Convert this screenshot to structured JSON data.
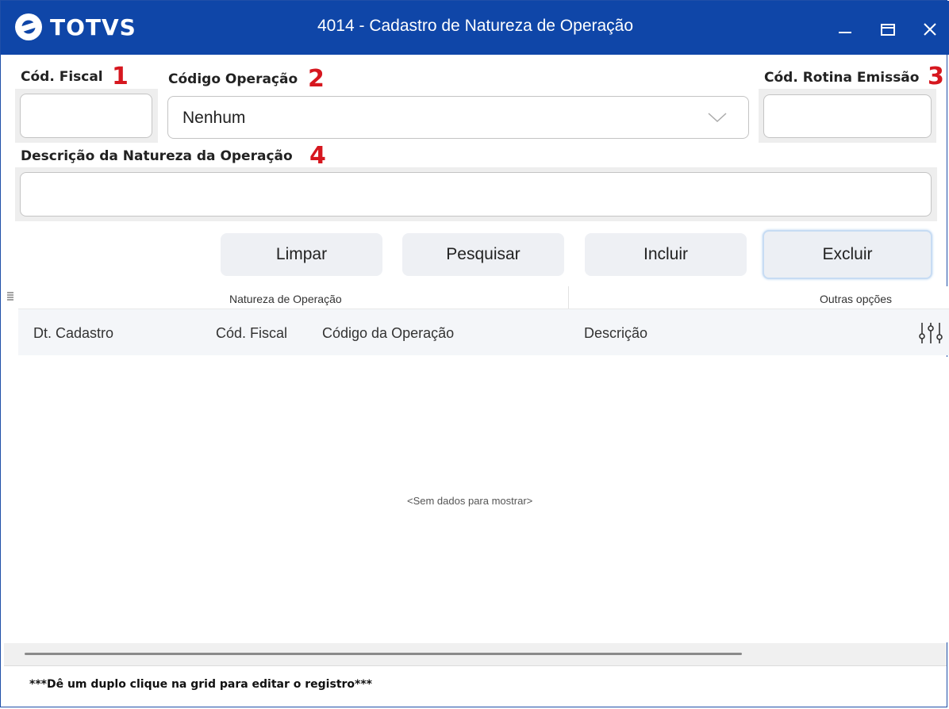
{
  "app": {
    "brand": "TOTVS",
    "title": "4014 - Cadastro de Natureza de Operação"
  },
  "fields": {
    "cod_fiscal": {
      "label": "Cód. Fiscal",
      "marker": "1",
      "value": ""
    },
    "codigo_operacao": {
      "label": "Código Operação",
      "marker": "2",
      "selected": "Nenhum"
    },
    "cod_rotina": {
      "label": "Cód. Rotina Emissão",
      "marker": "3",
      "value": ""
    },
    "descricao": {
      "label": "Descrição da Natureza da Operação",
      "marker": "4",
      "value": ""
    }
  },
  "buttons": {
    "limpar": "Limpar",
    "pesquisar": "Pesquisar",
    "incluir": "Incluir",
    "excluir": "Excluir"
  },
  "grid": {
    "group_headers": [
      "Natureza de Operação",
      "Outras opções"
    ],
    "columns": [
      "Dt. Cadastro",
      "Cód. Fiscal",
      "Código da Operação",
      "Descrição"
    ],
    "empty_text": "<Sem dados para mostrar>"
  },
  "footer": {
    "hint": "***Dê um duplo clique na grid para editar o registro***"
  },
  "colors": {
    "titlebar": "#0f46a8",
    "marker": "#d6171f"
  }
}
